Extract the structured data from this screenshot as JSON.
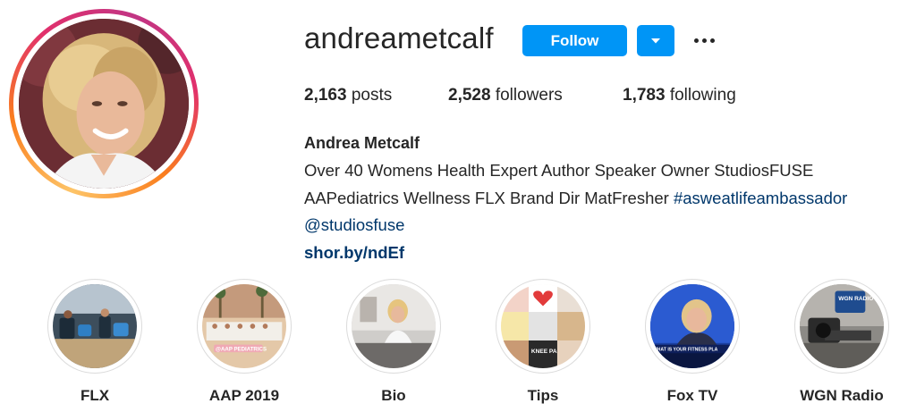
{
  "profile": {
    "username": "andreametcalf",
    "follow_label": "Follow",
    "avatar_icon": "profile-photo"
  },
  "stats": {
    "posts_count": "2,163",
    "posts_label": " posts",
    "followers_count": "2,528",
    "followers_label": " followers",
    "following_count": "1,783",
    "following_label": " following"
  },
  "bio": {
    "name": "Andrea Metcalf",
    "line1": "Over 40 Womens Health Expert Author Speaker Owner StudiosFUSE",
    "line2_text": "AAPediatrics Wellness FLX Brand Dir MatFresher ",
    "line2_hashtag": "#asweatlifeambassador",
    "line3_mention": "@studiosfuse",
    "url": "shor.by/ndEf"
  },
  "highlights": [
    {
      "label": "FLX"
    },
    {
      "label": "AAP 2019",
      "image_caption": "@AAP PEDIATRICS"
    },
    {
      "label": "Bio"
    },
    {
      "label": "Tips",
      "image_caption": "KNEE PAIN"
    },
    {
      "label": "Fox TV",
      "image_caption": "WHAT IS YOUR FITNESS PLA"
    },
    {
      "label": "WGN Radio",
      "image_caption": "WGN RADIO"
    }
  ],
  "colors": {
    "follow_button": "#0095f6",
    "link": "#00376b",
    "text": "#262626"
  }
}
